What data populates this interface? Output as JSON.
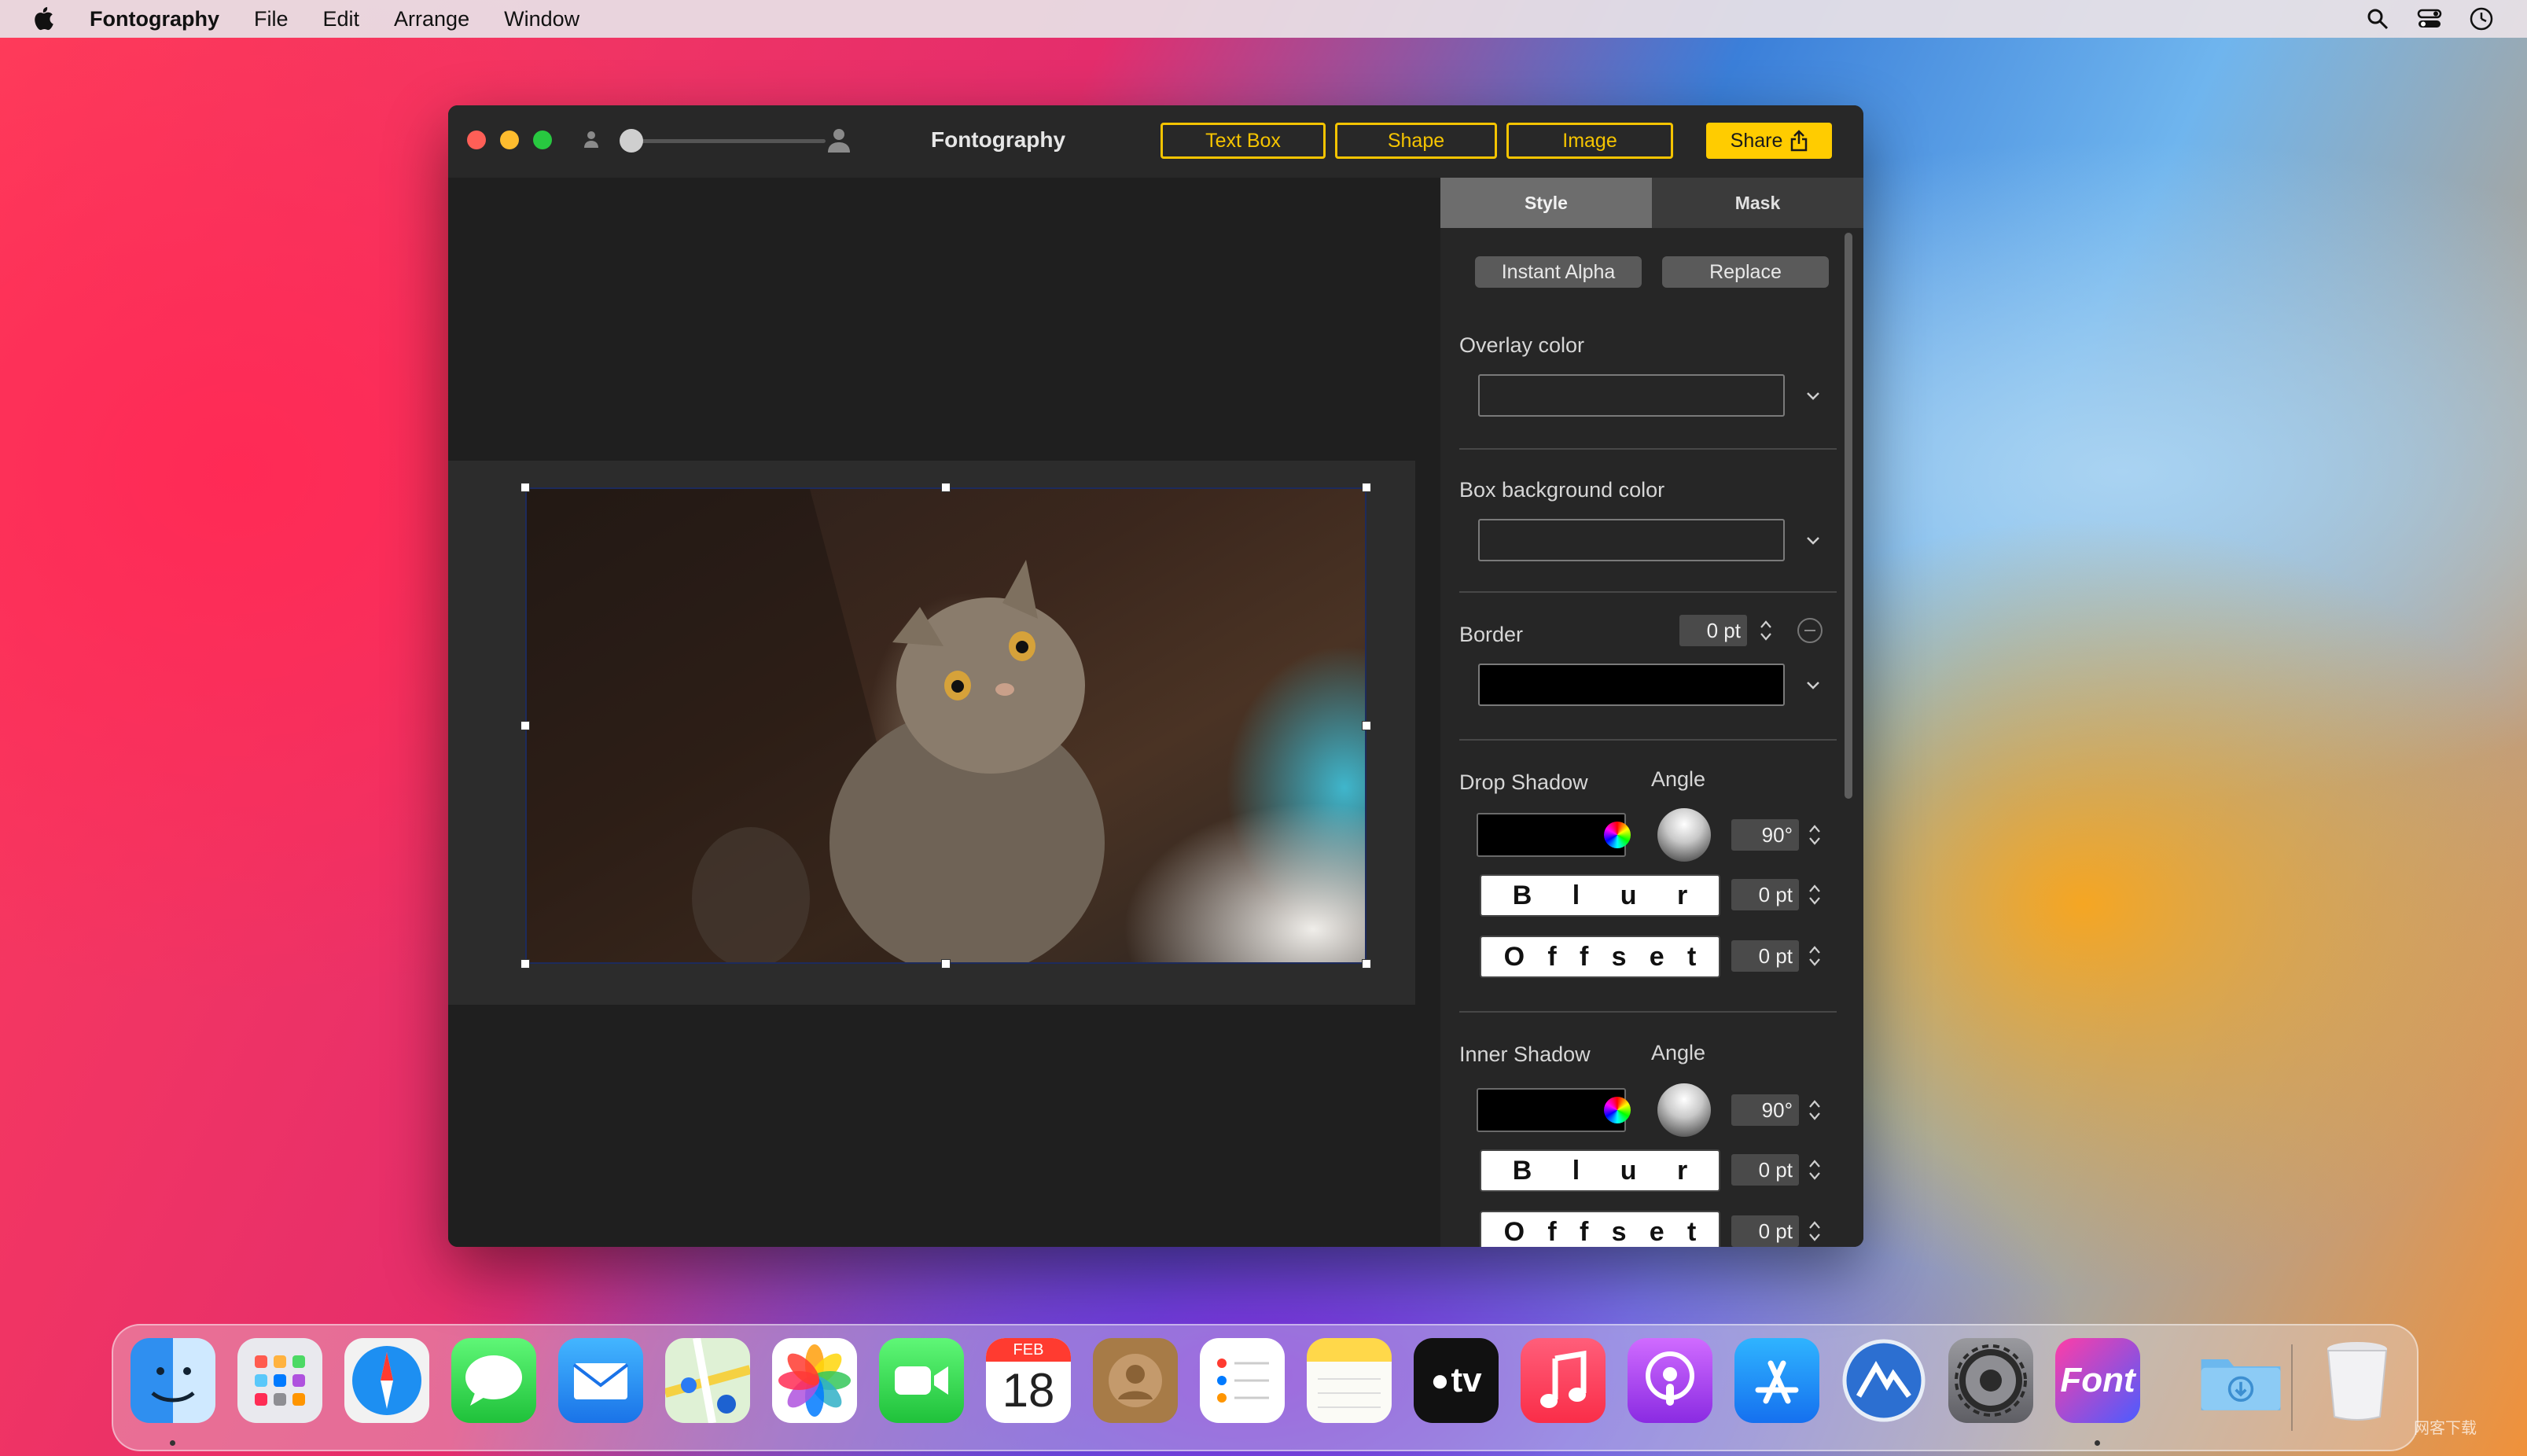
{
  "menubar": {
    "app_name": "Fontography",
    "items": [
      "File",
      "Edit",
      "Arrange",
      "Window"
    ],
    "icons": [
      "apple-icon",
      "search-icon",
      "control-center-icon",
      "clock-icon"
    ]
  },
  "window": {
    "title": "Fontography",
    "toolbar": {
      "text_box_label": "Text Box",
      "shape_label": "Shape",
      "image_label": "Image",
      "share_label": "Share"
    },
    "accent_color": "#f5c400"
  },
  "panel": {
    "tabs": [
      "Style",
      "Mask"
    ],
    "active_tab": "Style",
    "instant_alpha_label": "Instant Alpha",
    "replace_label": "Replace",
    "overlay_color_label": "Overlay color",
    "box_background_label": "Box background color",
    "border_label": "Border",
    "border_value": "0 pt",
    "drop_shadow": {
      "label": "Drop Shadow",
      "angle_label": "Angle",
      "angle_value": "90°",
      "blur_letters": [
        "B",
        "l",
        "u",
        "r"
      ],
      "blur_value": "0 pt",
      "offset_letters": [
        "O",
        "f",
        "f",
        "s",
        "e",
        "t"
      ],
      "offset_value": "0 pt"
    },
    "inner_shadow": {
      "label": "Inner Shadow",
      "angle_label": "Angle",
      "angle_value": "90°",
      "blur_letters": [
        "B",
        "l",
        "u",
        "r"
      ],
      "blur_value": "0 pt",
      "offset_letters": [
        "O",
        "f",
        "f",
        "s",
        "e",
        "t"
      ],
      "offset_value": "0 pt"
    }
  },
  "calendar": {
    "month": "FEB",
    "day": "18"
  },
  "dock": {
    "apps": [
      "Finder",
      "Launchpad",
      "Safari",
      "Messages",
      "Mail",
      "Maps",
      "Photos",
      "FaceTime",
      "Calendar",
      "Contacts",
      "Reminders",
      "Notes",
      "TV",
      "Music",
      "Podcasts",
      "App Store",
      "Toolbox",
      "System Preferences",
      "Fontography",
      "Downloads",
      "Trash"
    ],
    "tv_label": "tv",
    "font_label": "Font"
  },
  "watermark": "网客下载"
}
